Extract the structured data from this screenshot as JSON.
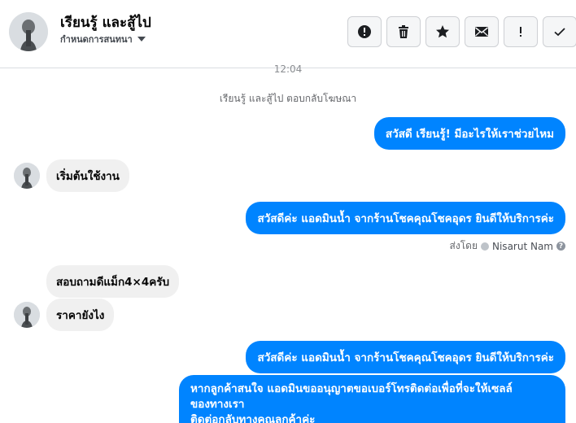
{
  "header": {
    "title": "เรียนรู้ และสู้ไป",
    "subtitle": "กำหนดการสนทนา",
    "toolbar": [
      {
        "icon": "alert-circle-icon"
      },
      {
        "icon": "trash-icon"
      },
      {
        "icon": "star-icon"
      },
      {
        "icon": "mail-icon"
      },
      {
        "icon": "exclamation-icon"
      },
      {
        "icon": "check-icon"
      }
    ]
  },
  "conversation": {
    "time": "12:04",
    "system_message": "เรียนรู้ และสู้ไป ตอบกลับโฆษณา",
    "messages": [
      {
        "dir": "out",
        "text": "สวัสดี เรียนรู้! มีอะไรให้เราช่วยไหม"
      },
      {
        "dir": "in",
        "text": "เริ่มต้นใช้งาน"
      },
      {
        "dir": "out",
        "text": "สวัสดีค่ะ แอดมินน้ำ จากร้านโชคคุณโชคอุดร ยินดีให้บริการค่ะ"
      },
      {
        "dir": "in",
        "text": "สอบถามดีแม็ก4×4ครับ"
      },
      {
        "dir": "in",
        "text": "ราคายังไง"
      },
      {
        "dir": "out",
        "text": "สวัสดีค่ะ แอดมินน้ำ จากร้านโชคคุณโชคอุดร ยินดีให้บริการค่ะ"
      },
      {
        "dir": "out",
        "line1": "หากลูกค้าสนใจ แอดมินขออนุญาตขอเบอร์โทรติดต่อเพื่อที่จะให้เซลล์",
        "line2": "ของทางเรา",
        "line3": "ติดต่อกลับทางคุณลูกค้าค่ะ"
      }
    ],
    "sent_by_label": "ส่งโดย",
    "sent_by_name": "Nisarut Nam"
  },
  "colors": {
    "outgoing_bubble": "#0084ff",
    "incoming_bubble": "#f0f0f0"
  }
}
